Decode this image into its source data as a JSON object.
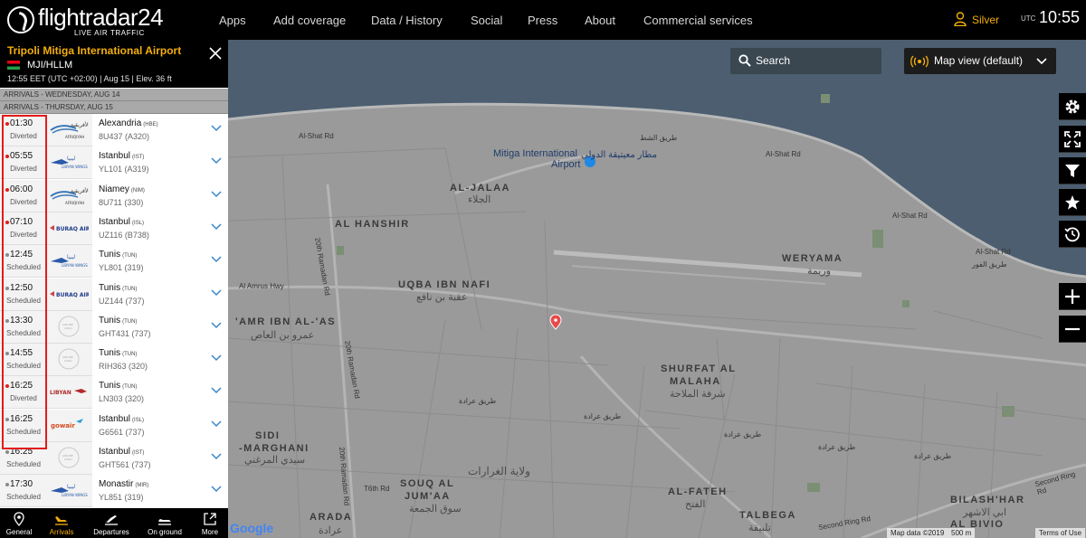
{
  "header": {
    "brand": "flightradar24",
    "brand_sub": "LIVE AIR TRAFFIC",
    "nav": [
      "Apps",
      "Add coverage",
      "Data / History",
      "Social",
      "Press",
      "About",
      "Commercial services"
    ],
    "account": "Silver",
    "utc_label": "UTC",
    "time": "10:55"
  },
  "airport": {
    "name": "Tripoli Mitiga International Airport",
    "code": "MJI/HLLM",
    "meta": "12:55  EET (UTC +02:00)  |  Aug 15  |  Elev. 36 ft",
    "day_prev": "ARRIVALS - WEDNESDAY, AUG 14",
    "day_curr": "ARRIVALS - THURSDAY, AUG 15"
  },
  "flights": [
    {
      "time": "01:30",
      "status": "Diverted",
      "city": "Alexandria",
      "iata": "(HBE)",
      "flight": "8U437 (A320)",
      "airline": "Afriqiyah"
    },
    {
      "time": "05:55",
      "status": "Diverted",
      "city": "Istanbul",
      "iata": "(IST)",
      "flight": "YL101 (A319)",
      "airline": "Libyan Wings"
    },
    {
      "time": "06:00",
      "status": "Diverted",
      "city": "Niamey",
      "iata": "(NIM)",
      "flight": "8U711 (330)",
      "airline": "Afriqiyah"
    },
    {
      "time": "07:10",
      "status": "Diverted",
      "city": "Istanbul",
      "iata": "(ISL)",
      "flight": "UZ116 (B738)",
      "airline": "Buraq Air"
    },
    {
      "time": "12:45",
      "status": "Scheduled",
      "city": "Tunis",
      "iata": "(TUN)",
      "flight": "YL801 (319)",
      "airline": "Libyan Wings"
    },
    {
      "time": "12:50",
      "status": "Scheduled",
      "city": "Tunis",
      "iata": "(TUN)",
      "flight": "UZ144 (737)",
      "airline": "Buraq Air"
    },
    {
      "time": "13:30",
      "status": "Scheduled",
      "city": "Tunis",
      "iata": "(TUN)",
      "flight": "GHT431 (737)",
      "airline": "Airline logo"
    },
    {
      "time": "14:55",
      "status": "Scheduled",
      "city": "Tunis",
      "iata": "(TUN)",
      "flight": "RIH363 (320)",
      "airline": "Airline logo"
    },
    {
      "time": "16:25",
      "status": "Diverted",
      "city": "Tunis",
      "iata": "(TUN)",
      "flight": "LN303 (320)",
      "airline": "Libyan"
    },
    {
      "time": "16:25",
      "status": "Scheduled",
      "city": "Istanbul",
      "iata": "(ISL)",
      "flight": "G6561 (737)",
      "airline": "gowair"
    },
    {
      "time": "16:25",
      "status": "Scheduled",
      "city": "Istanbul",
      "iata": "(IST)",
      "flight": "GHT561 (737)",
      "airline": "Airline logo"
    },
    {
      "time": "17:30",
      "status": "Scheduled",
      "city": "Monastir",
      "iata": "(MIR)",
      "flight": "YL851 (319)",
      "airline": "Libyan Wings"
    }
  ],
  "tabs": [
    "General",
    "Arrivals",
    "Departures",
    "On ground",
    "More"
  ],
  "map": {
    "search_placeholder": "Search",
    "view_label": "Map view (default)",
    "airport_label_1": "Mitiga International",
    "airport_label_2": "Airport",
    "airport_label_ar": "مطار معيتيقة الدولي",
    "districts": [
      {
        "en": "AL-JALAA",
        "ar": "الجلاء"
      },
      {
        "en": "AL HANSHIR",
        "ar": ""
      },
      {
        "en": "UQBA IBN NAFI",
        "ar": "عقبة بن نافع"
      },
      {
        "en": "'AMR IBN AL-'AS",
        "ar": "عمرو بن العاص"
      },
      {
        "en": "WERYAMA",
        "ar": "وريمة"
      },
      {
        "en": "SHURFAT AL",
        "ar": ""
      },
      {
        "en": "MALAHA",
        "ar": "شرفة الملاحة"
      },
      {
        "en": "SIDI",
        "ar": ""
      },
      {
        "en": "-MARGHANI",
        "ar": "سيدي المرغني"
      },
      {
        "en": "SOUQ AL",
        "ar": ""
      },
      {
        "en": "JUM'AA",
        "ar": "سوق الجمعة"
      },
      {
        "en": "AL-FATEH",
        "ar": "الفتح"
      },
      {
        "en": "ARADA",
        "ar": "عرادة"
      },
      {
        "en": "TALBEGA",
        "ar": "تلبيقة"
      },
      {
        "en": "BILASH'HAR",
        "ar": "ابي الاشهر"
      },
      {
        "en": "AL BIVIO",
        "ar": ""
      }
    ],
    "wilaya_ar": "ولاية الغرارات",
    "roads": [
      "Al-Shat Rd",
      "طريق الشط",
      "Al-Shat Rd",
      "Al-Shat Rd",
      "Al Amrus Hwy",
      "20th Ramadan Rd",
      "20th Ramadan Rd",
      "20th Ramadan Rd",
      "T6th Rd",
      "Second Ring Rd",
      "Second Ring Rd",
      "Al-Shat Rd",
      "طريق عرادة",
      "طريق عرادة",
      "طريق عرادة",
      "طريق عرادة",
      "طريق عرادة",
      "طريق الفور"
    ],
    "attribution": "Map data ©2019",
    "scale": "500 m",
    "terms": "Terms of Use",
    "google": "Google"
  },
  "colors": {
    "accent": "#f4ae0c",
    "diverted": "#e21b1b",
    "scheduled": "#8a8a8a",
    "sea": "#4c5e70",
    "land": "#9a9a9a",
    "park": "#7a8f73"
  }
}
